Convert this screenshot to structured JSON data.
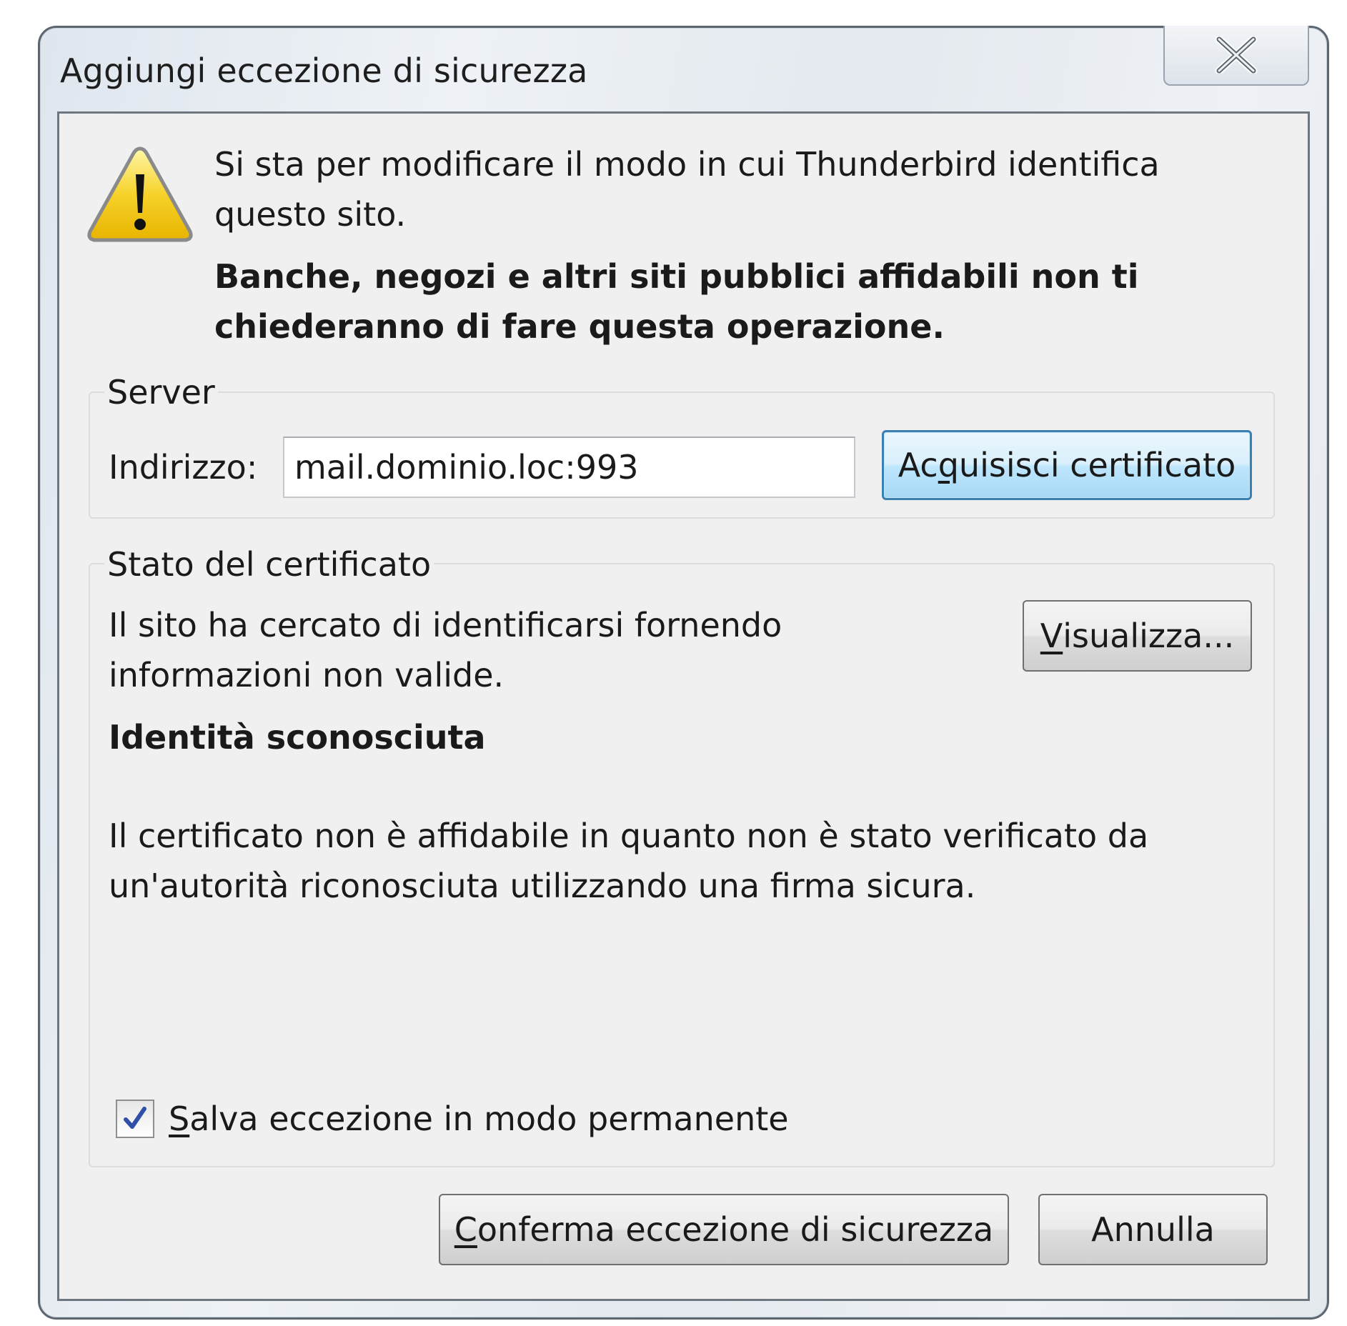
{
  "window": {
    "title": "Aggiungi eccezione di sicurezza",
    "close_icon": "close-x-icon"
  },
  "warning": {
    "icon": "warning-triangle-icon",
    "line1": "Si sta per modificare il modo in cui Thunderbird identifica",
    "line2": "questo sito.",
    "bold_line1": "Banche, negozi e altri siti pubblici affidabili non ti",
    "bold_line2": "chiederanno di fare questa operazione."
  },
  "server": {
    "legend": "Server",
    "address_label": "Indirizzo:",
    "address_value": "mail.dominio.loc:993",
    "get_cert_button": {
      "pre": "Ac",
      "accel": "q",
      "post": "uisisci certificato"
    }
  },
  "cert_status": {
    "legend": "Stato del certificato",
    "line1": "Il sito ha cercato di identificarsi fornendo",
    "line2": "informazioni non valide.",
    "view_button": {
      "accel": "V",
      "post": "isualizza..."
    },
    "identity_title": "Identità sconosciuta",
    "detail_line1": "Il certificato non è affidabile in quanto non è stato verificato da",
    "detail_line2": "un'autorità riconosciuta utilizzando una firma sicura.",
    "permanent_checkbox": {
      "checked": true,
      "accel": "S",
      "post": "alva eccezione in modo permanente"
    }
  },
  "footer": {
    "confirm_button": {
      "accel": "C",
      "post": "onferma eccezione di sicurezza"
    },
    "cancel_button": "Annulla"
  },
  "colors": {
    "client_bg": "#f0f0f0",
    "focus_border": "#3c7fb1",
    "checkmark": "#2f4fa8",
    "warning_yellow": "#f5c518"
  }
}
